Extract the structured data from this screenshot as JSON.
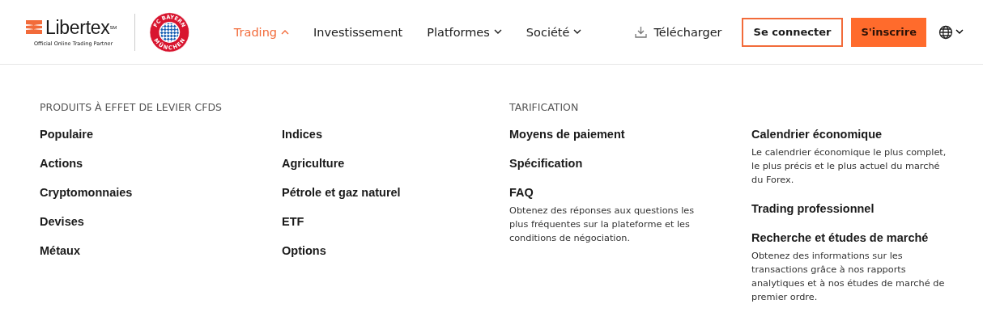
{
  "header": {
    "logo": {
      "name": "Libertex$^{SM}$",
      "tagline": "Official Online Trading Partner"
    },
    "club_badge": {
      "top": "FC BAYERN",
      "bottom": "MÜNCHEN"
    },
    "nav": [
      {
        "label": "Trading",
        "kind": "dropdown",
        "selected": true,
        "expanded": true
      },
      {
        "label": "Investissement",
        "kind": "link",
        "selected": false
      },
      {
        "label": "Platformes",
        "kind": "dropdown",
        "selected": false,
        "expanded": false
      },
      {
        "label": "Société",
        "kind": "dropdown",
        "selected": false,
        "expanded": false
      }
    ],
    "download": "Télécharger",
    "login": "Se connecter",
    "signup": "S'inscrire"
  },
  "menu": [
    {
      "heading": "PRODUITS À EFFET DE LEVIER CFDS",
      "columns": [
        [
          {
            "title": "Populaire"
          },
          {
            "title": "Actions"
          },
          {
            "title": "Cryptomonnaies"
          },
          {
            "title": "Devises"
          },
          {
            "title": "Métaux"
          }
        ],
        [
          {
            "title": "Indices"
          },
          {
            "title": "Agriculture"
          },
          {
            "title": "Pétrole et gaz naturel"
          },
          {
            "title": "ETF"
          },
          {
            "title": "Options"
          }
        ]
      ]
    },
    {
      "heading": "TARIFICATION",
      "columns": [
        [
          {
            "title": "Moyens de paiement"
          },
          {
            "title": "Spécification"
          },
          {
            "title": "FAQ",
            "description": "Obtenez des réponses aux questions les plus fréquentes sur la plateforme et les conditions de négociation."
          }
        ],
        [
          {
            "title": "Calendrier économique",
            "description": "Le calendrier économique le plus complet, le plus précis et le plus actuel du marché du Forex."
          },
          {
            "title": "Trading professionnel"
          },
          {
            "title": "Recherche et études de marché",
            "description": "Obtenez des informations sur les transactions grâce à nos rapports analytiques et à nos études de marché de premier ordre."
          }
        ]
      ]
    }
  ]
}
